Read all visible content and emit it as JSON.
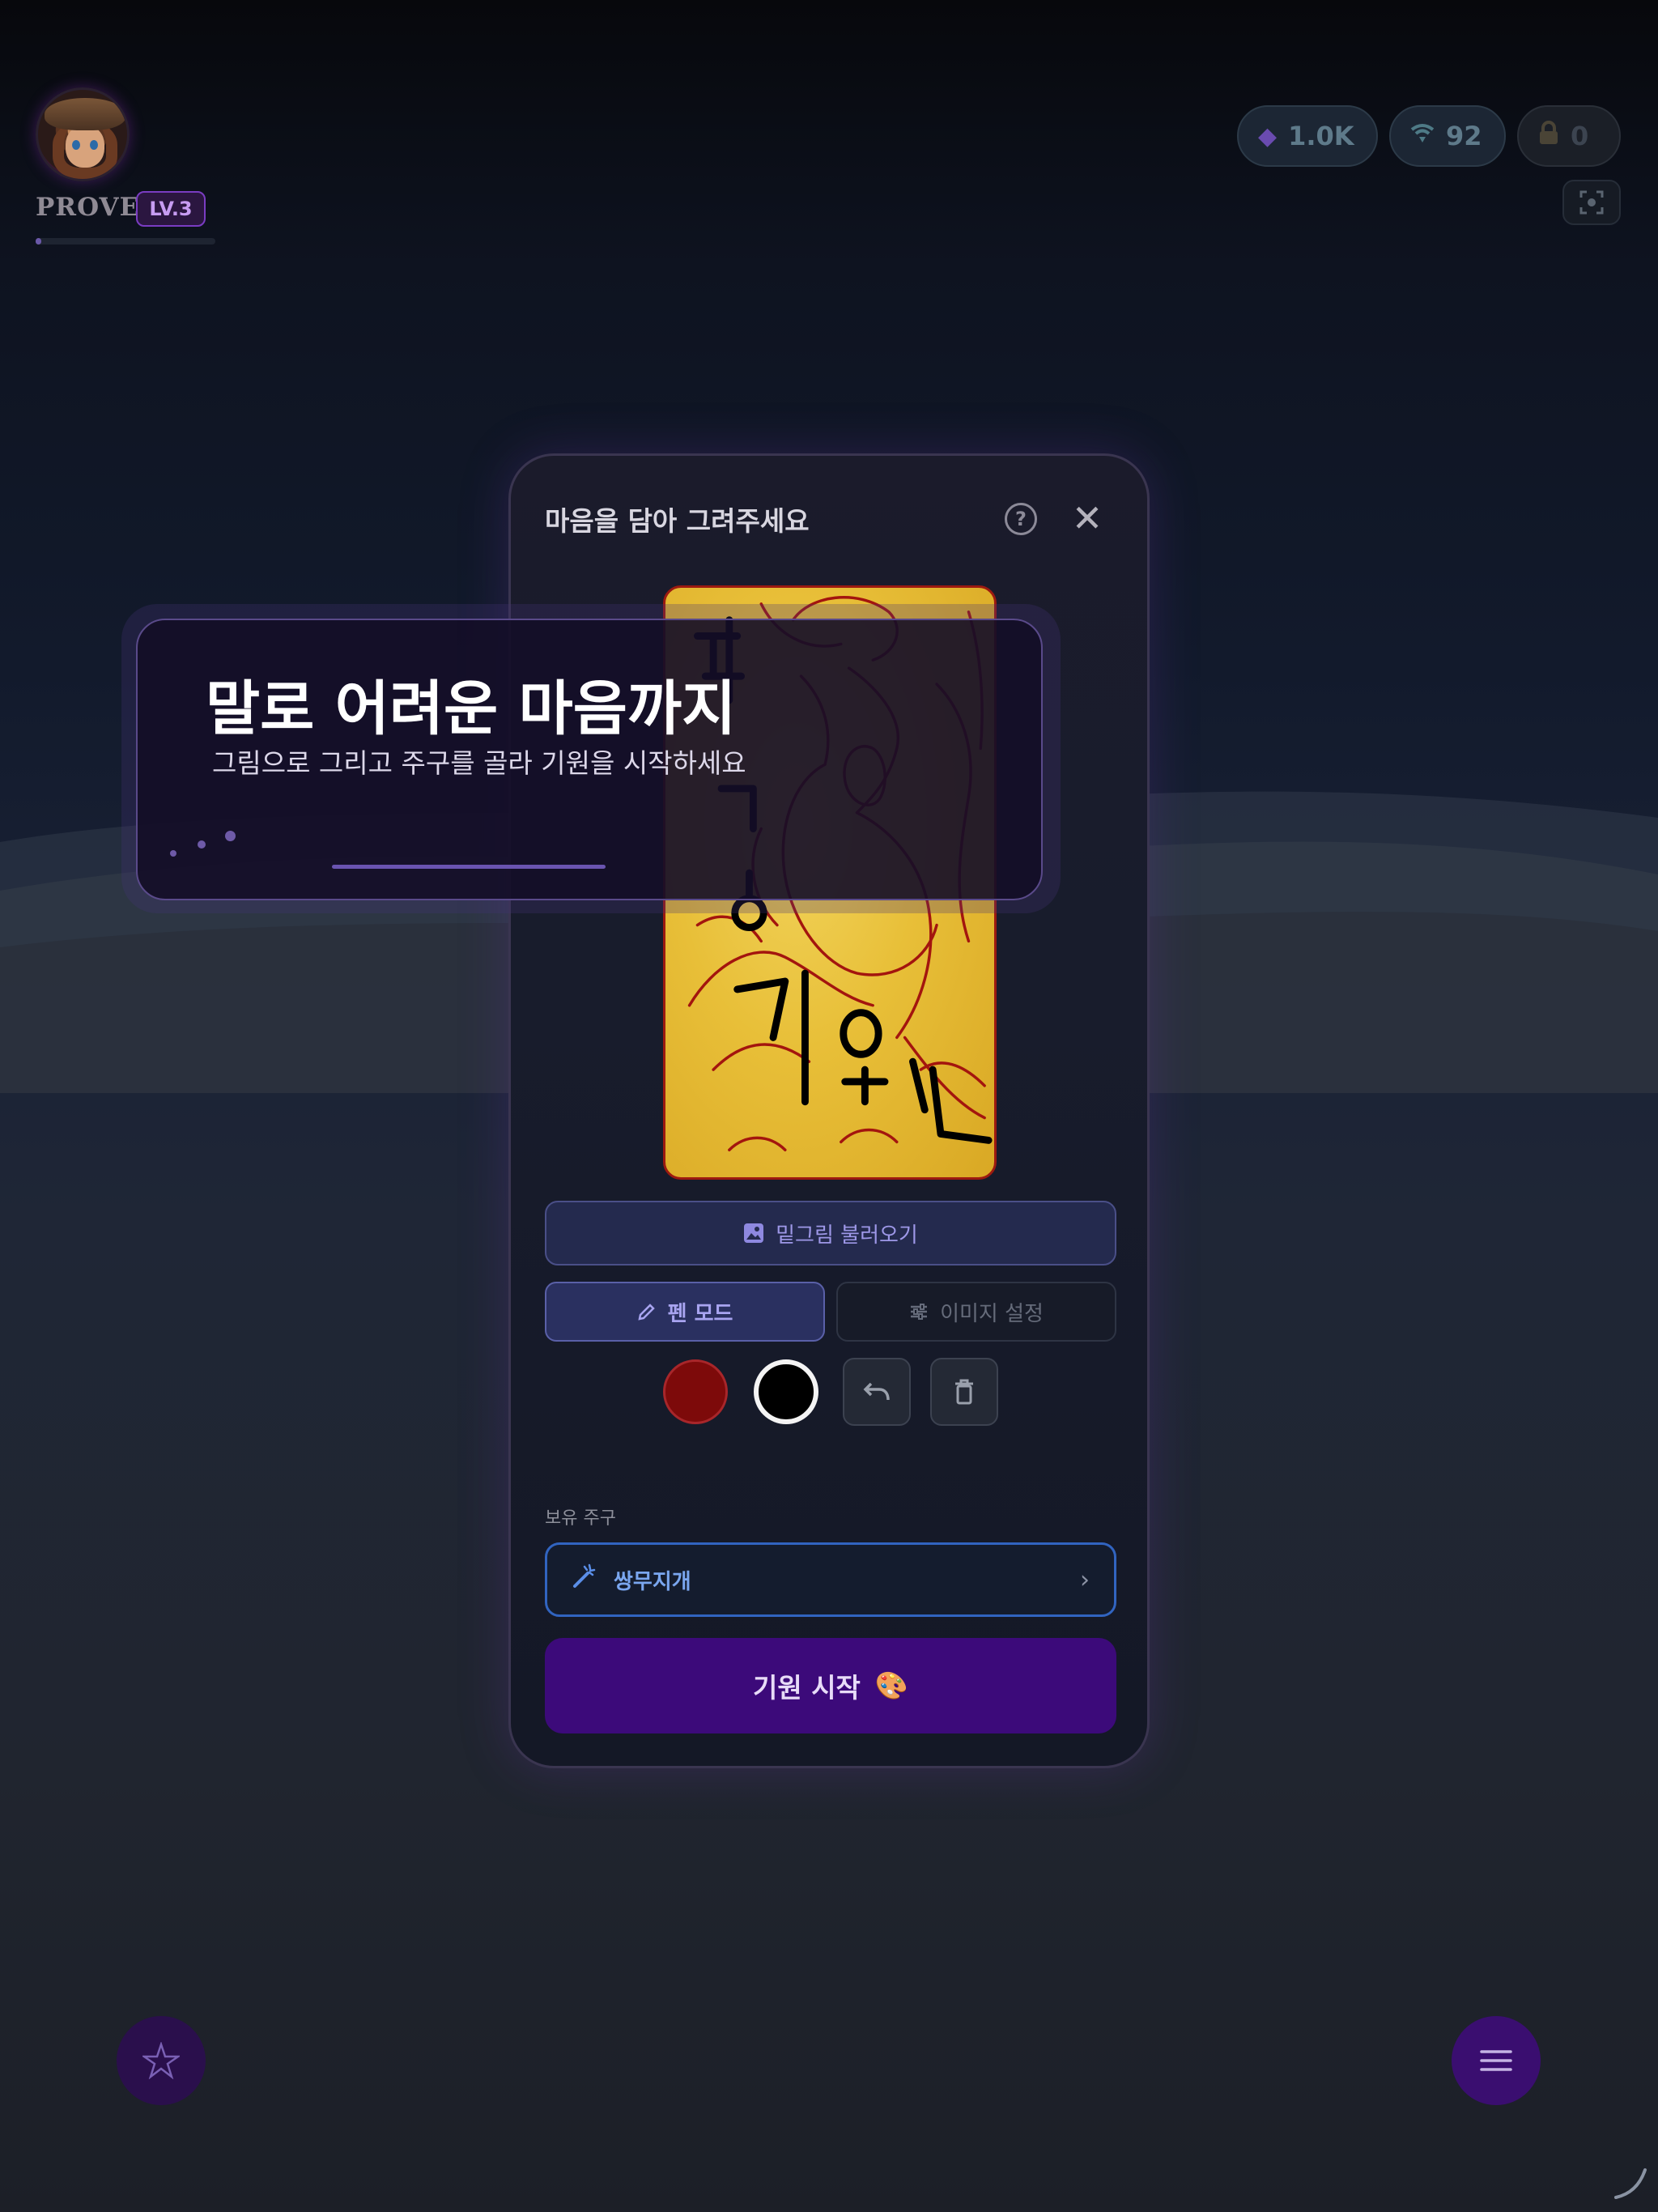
{
  "statusbar": {
    "time": "",
    "right": ""
  },
  "profile": {
    "name": "PROVE",
    "level": "LV.3",
    "xp_fraction": 0.03
  },
  "currencies": {
    "gems": {
      "icon": "gem-icon",
      "value": "1.0K"
    },
    "signal": {
      "icon": "wifi-icon",
      "value": "92"
    },
    "locked": {
      "icon": "lock-icon",
      "value": "0"
    }
  },
  "modal": {
    "title": "마음을 담아 그려주세요",
    "help_icon": "?",
    "close_icon": "✕",
    "load_button": "밑그림 불러오기",
    "pen_mode": "펜 모드",
    "image_settings": "이미지 설정",
    "colors": [
      "#7d0a0a",
      "#000000"
    ],
    "selected_color": "#000000",
    "owned_spells_label": "보유 주구",
    "selected_spell": "쌍무지개",
    "start_button": "기원 시작",
    "start_emoji": "🎨"
  },
  "toast": {
    "title": "말로 어려운 마음까지",
    "subtitle": "그림으로 그리고 주구를 골라 기원을 시작하세요"
  },
  "fabs": {
    "left_icon": "star-icon",
    "right_icon": "menu-icon"
  }
}
